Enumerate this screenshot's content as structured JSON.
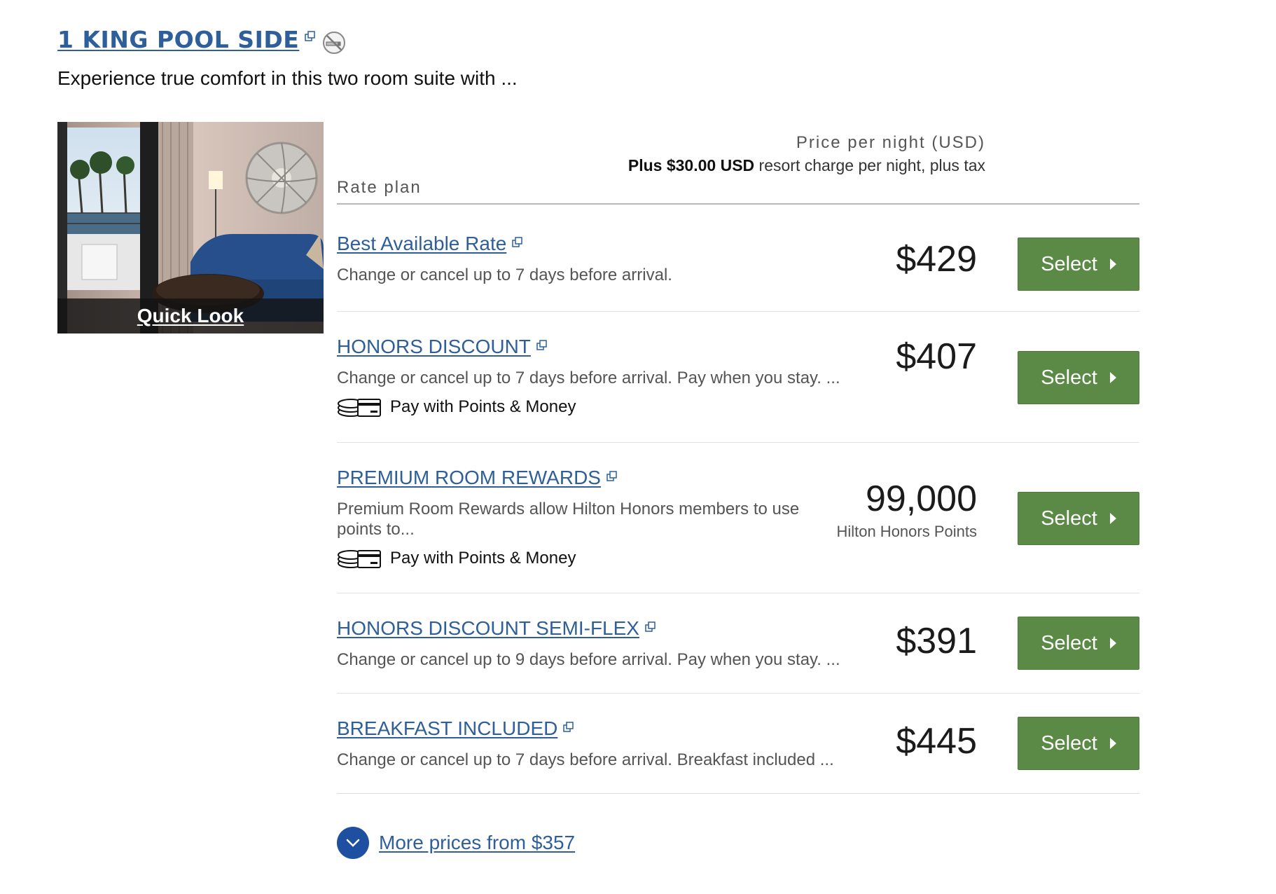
{
  "room": {
    "title": "1 KING POOL SIDE",
    "description": "Experience true comfort in this two room suite with ...",
    "quick_look_label": "Quick Look"
  },
  "rates_table": {
    "header_rate_plan": "Rate plan",
    "header_price": "Price per night (USD)",
    "resort_charge_bold": "Plus $30.00 USD",
    "resort_charge_rest": " resort charge per night, plus tax"
  },
  "rates": [
    {
      "name": "Best Available Rate",
      "description": "Change or cancel up to 7 days before arrival.",
      "price": "$429",
      "select_label": "Select"
    },
    {
      "name": "HONORS DISCOUNT",
      "description": "Change or cancel up to 7 days before arrival. Pay when you stay. ...",
      "points_money_label": "Pay with Points & Money",
      "price": "$407",
      "select_label": "Select"
    },
    {
      "name": "PREMIUM ROOM REWARDS",
      "description": "Premium Room Rewards allow Hilton Honors members to use points to...",
      "points_money_label": "Pay with Points & Money",
      "price": "99,000",
      "price_sub": "Hilton Honors Points",
      "select_label": "Select"
    },
    {
      "name": "HONORS DISCOUNT SEMI-FLEX",
      "description": "Change or cancel up to 9 days before arrival. Pay when you stay. ...",
      "price": "$391",
      "select_label": "Select"
    },
    {
      "name": "BREAKFAST INCLUDED",
      "description": "Change or cancel up to 7 days before arrival. Breakfast included ...",
      "price": "$445",
      "select_label": "Select"
    }
  ],
  "more_prices_label": "More prices from $357",
  "colors": {
    "link": "#2f5f9a",
    "select_button": "#5a8a46",
    "more_circle": "#1f4fa0"
  },
  "icons": [
    "external-link-icon",
    "no-smoking-icon",
    "points-money-icon",
    "chevron-down-icon",
    "caret-right-icon"
  ]
}
